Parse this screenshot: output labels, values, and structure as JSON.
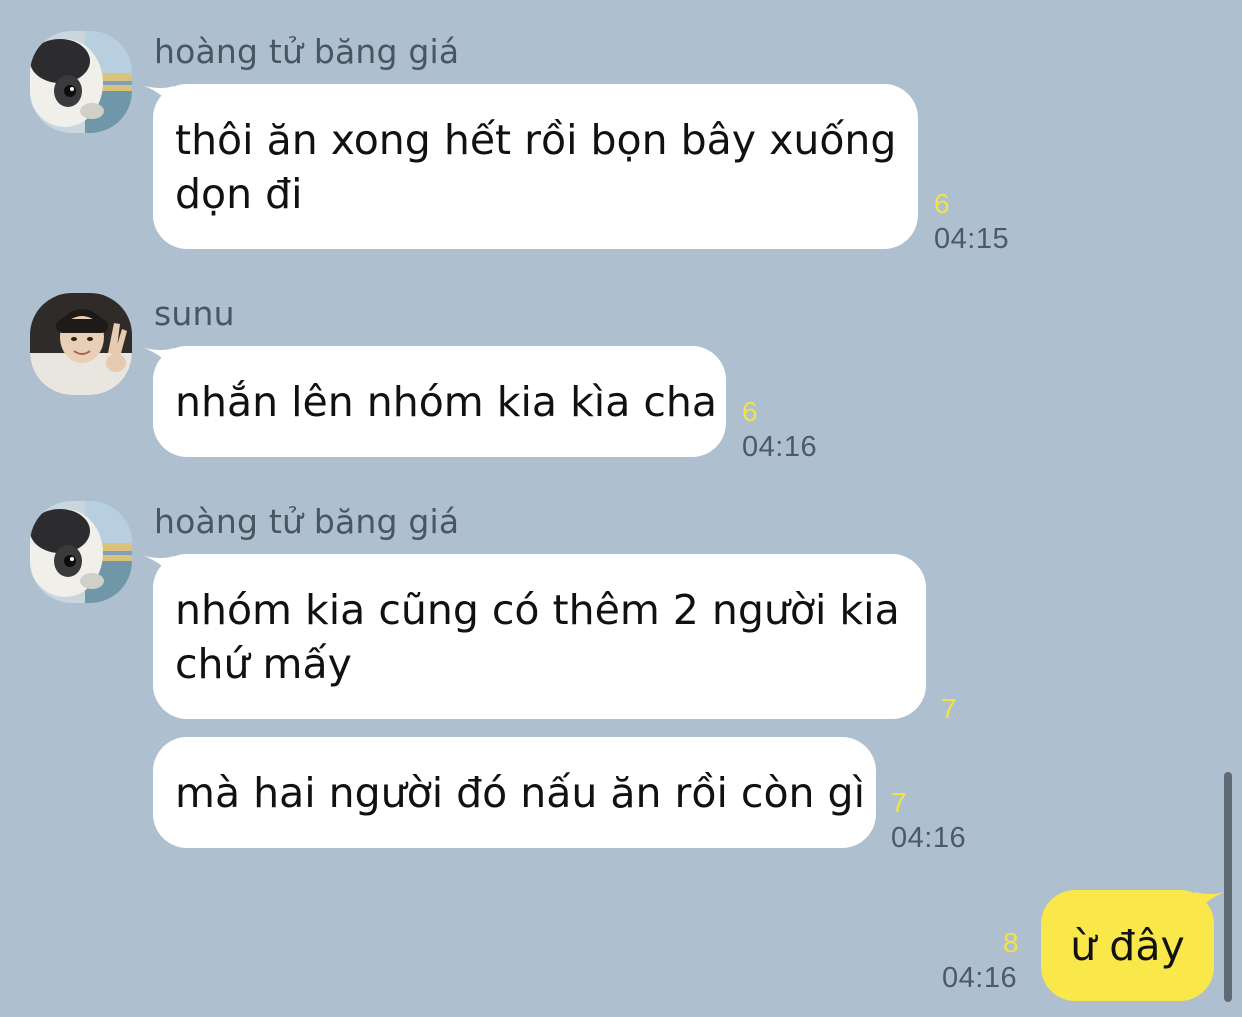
{
  "messages": [
    {
      "sender": "hoàng tử băng giá",
      "avatar": "penguin-avatar",
      "bubbles": [
        {
          "lines": [
            "thôi ăn xong hết rồi bọn bây xuống",
            "dọn đi"
          ],
          "unread": "6",
          "time": "04:15"
        }
      ]
    },
    {
      "sender": "sunu",
      "avatar": "person-avatar",
      "bubbles": [
        {
          "lines": [
            "nhắn lên nhóm kia kìa cha"
          ],
          "unread": "6",
          "time": "04:16"
        }
      ]
    },
    {
      "sender": "hoàng tử băng giá",
      "avatar": "penguin-avatar",
      "bubbles": [
        {
          "lines": [
            "nhóm kia cũng có thêm 2 người kia",
            "chứ mấy"
          ],
          "unread": "7",
          "time": ""
        },
        {
          "lines": [
            "mà hai người đó nấu ăn rồi còn gì"
          ],
          "unread": "7",
          "time": "04:16"
        }
      ]
    }
  ],
  "my_message": {
    "text": "ừ đây",
    "unread": "8",
    "time": "04:16"
  },
  "colors": {
    "background": "#aebfd0",
    "incoming_bubble": "#ffffff",
    "outgoing_bubble": "#fae74a",
    "unread_count": "#f1e24a",
    "timestamp": "#4d5966",
    "sender_name": "#4a5560"
  }
}
